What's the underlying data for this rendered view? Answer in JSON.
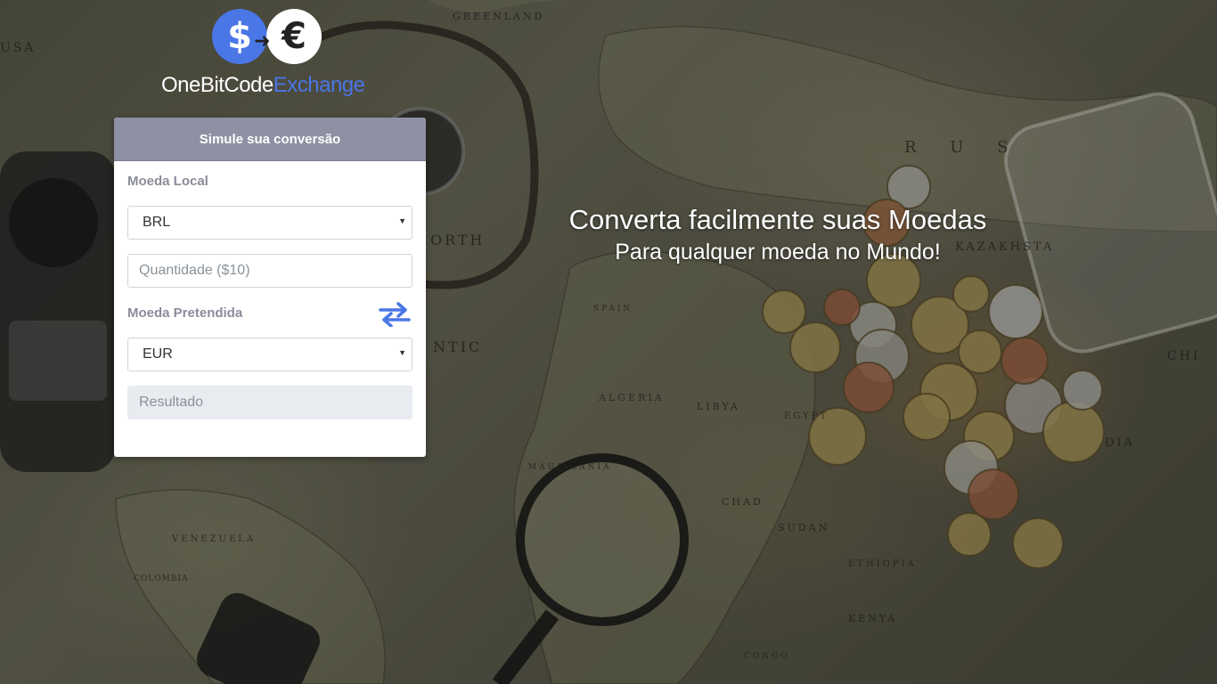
{
  "logo": {
    "dollar_symbol": "$",
    "euro_symbol": "€",
    "brand_main": "OneBitCode",
    "brand_accent": "Exchange",
    "accent_color": "#4a76e6"
  },
  "background": {
    "map_labels": [
      "GREENLAND",
      "R U S",
      "ORTH",
      "SPAIN",
      "ALGERIA",
      "LIBYA",
      "EGYPT",
      "MAURITANIA",
      "CHAD",
      "SUDAN",
      "ETHIOPIA",
      "KENYA",
      "CONGO",
      "VENEZUELA",
      "COLOMBIA",
      "KAZAKHSTA",
      "NTIC",
      "CHI",
      "DIA",
      "USA"
    ]
  },
  "converter": {
    "header": "Simule sua conversão",
    "local_currency_label": "Moeda Local",
    "local_currency_value": "BRL",
    "amount_placeholder": "Quantidade ($10)",
    "target_currency_label": "Moeda Pretendida",
    "target_currency_value": "EUR",
    "result_placeholder": "Resultado",
    "swap_icon": "swap-arrows-icon"
  },
  "hero": {
    "title": "Converta facilmente suas Moedas",
    "subtitle": "Para qualquer moeda no Mundo!"
  }
}
